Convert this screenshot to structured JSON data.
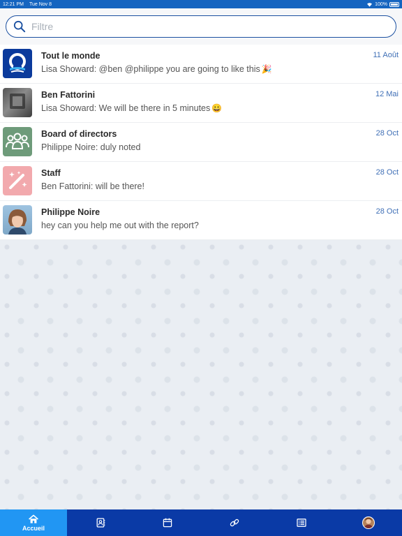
{
  "status_bar": {
    "time": "12:21 PM",
    "date": "Tue Nov 8",
    "battery": "100%"
  },
  "search": {
    "placeholder": "Filtre",
    "value": ""
  },
  "conversations": [
    {
      "name": "Tout le monde",
      "preview": "Lisa Showard: @ben @philippe you are going to like this",
      "emoji": "🎉",
      "date": "11 Août",
      "avatar": "organization-logo"
    },
    {
      "name": "Ben Fattorini",
      "preview": "Lisa Showard: We will be there in 5 minutes",
      "emoji": "😀",
      "date": "12 Mai",
      "avatar": "photo"
    },
    {
      "name": "Board of directors",
      "preview": "Philippe Noire: duly noted",
      "emoji": "",
      "date": "28 Oct",
      "avatar": "group-icon"
    },
    {
      "name": "Staff",
      "preview": "Ben Fattorini: will be there!",
      "emoji": "",
      "date": "28 Oct",
      "avatar": "magic-wand-icon"
    },
    {
      "name": "Philippe Noire",
      "preview": "hey can you help me out with the report?",
      "emoji": "",
      "date": "28 Oct",
      "avatar": "photo"
    }
  ],
  "tab_bar": {
    "tabs": [
      {
        "label": "Accueil",
        "icon": "home-icon",
        "active": true
      },
      {
        "label": "",
        "icon": "contacts-icon",
        "active": false
      },
      {
        "label": "",
        "icon": "calendar-icon",
        "active": false
      },
      {
        "label": "",
        "icon": "link-icon",
        "active": false
      },
      {
        "label": "",
        "icon": "list-icon",
        "active": false
      },
      {
        "label": "",
        "icon": "profile-avatar",
        "active": false
      }
    ]
  },
  "colors": {
    "brand": "#0a3aa6",
    "active_tab": "#2196f3",
    "date": "#3f6fb6",
    "group_avatar": "#6e9b7a",
    "staff_avatar": "#f2a9ad"
  }
}
